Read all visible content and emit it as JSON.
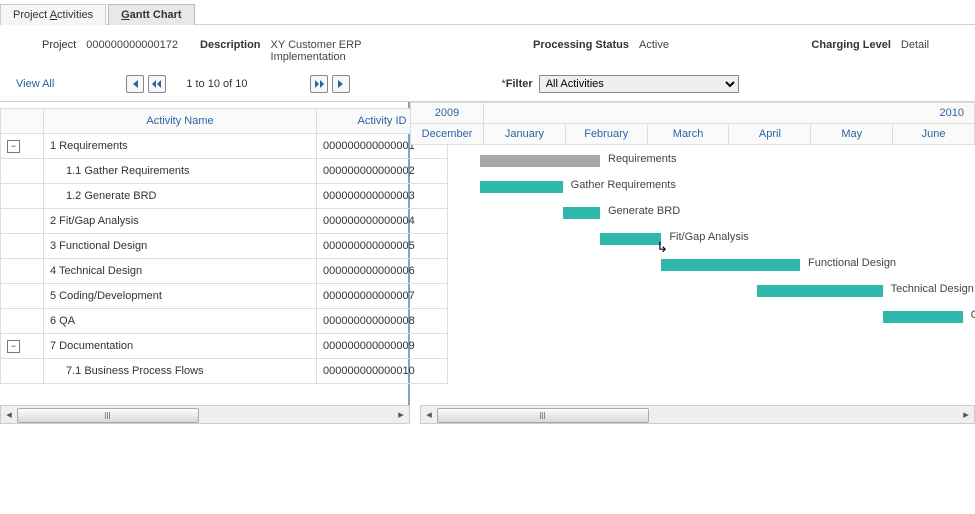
{
  "tabs": {
    "project_activities": "Project Activities",
    "gantt_chart": "Gantt Chart",
    "activities_underline_pos": 8,
    "gantt_underline_pos": 0
  },
  "meta": {
    "project_lbl": "Project",
    "project_val": "000000000000172",
    "desc_lbl": "Description",
    "desc_val": "XY Customer ERP Implementation",
    "status_lbl": "Processing Status",
    "status_val": "Active",
    "charge_lbl": "Charging Level",
    "charge_val": "Detail"
  },
  "nav": {
    "view_all": "View All",
    "page_info": "1 to 10 of 10",
    "filter_lbl": "Filter",
    "filter_value": "All Activities"
  },
  "grid": {
    "headers": {
      "name": "Activity Name",
      "id": "Activity ID"
    },
    "rows": [
      {
        "expand": true,
        "name": "1 Requirements",
        "id": "000000000000001",
        "indent": 0
      },
      {
        "name": "1.1 Gather Requirements",
        "id": "000000000000002",
        "indent": 1
      },
      {
        "name": "1.2 Generate BRD",
        "id": "000000000000003",
        "indent": 1
      },
      {
        "name": "2 Fit/Gap Analysis",
        "id": "000000000000004",
        "indent": 0
      },
      {
        "name": "3 Functional Design",
        "id": "000000000000005",
        "indent": 0
      },
      {
        "name": "4 Technical Design",
        "id": "000000000000006",
        "indent": 0
      },
      {
        "name": "5 Coding/Development",
        "id": "000000000000007",
        "indent": 0
      },
      {
        "name": "6 QA",
        "id": "000000000000008",
        "indent": 0
      },
      {
        "expand": true,
        "name": "7 Documentation",
        "id": "000000000000009",
        "indent": 0
      },
      {
        "name": "7.1 Business Process Flows",
        "id": "000000000000010",
        "indent": 1
      }
    ]
  },
  "timeline": {
    "year_left": "2009",
    "year_right": "2010",
    "months": [
      "December",
      "January",
      "February",
      "March",
      "April",
      "May",
      "June"
    ]
  },
  "chart_data": {
    "type": "bar",
    "title": "Gantt Chart",
    "xlabel": "",
    "ylabel": "",
    "categories": [
      "December 2009",
      "January 2010",
      "February 2010",
      "March 2010",
      "April 2010",
      "May 2010",
      "June 2010"
    ],
    "series": [
      {
        "name": "Requirements",
        "start": "2010-01-01",
        "end": "2010-02-15",
        "summary": true
      },
      {
        "name": "Gather Requirements",
        "start": "2010-01-01",
        "end": "2010-02-01"
      },
      {
        "name": "Generate BRD",
        "start": "2010-02-01",
        "end": "2010-02-15"
      },
      {
        "name": "Fit/Gap Analysis",
        "start": "2010-02-15",
        "end": "2010-03-10"
      },
      {
        "name": "Functional Design",
        "start": "2010-03-10",
        "end": "2010-05-01"
      },
      {
        "name": "Technical Design",
        "start": "2010-04-15",
        "end": "2010-06-01"
      },
      {
        "name": "Coding/Development",
        "start": "2010-06-01",
        "end": "2010-07-01"
      }
    ],
    "xlim": [
      "2009-12-01",
      "2010-07-01"
    ],
    "ylim": [
      0,
      10
    ]
  }
}
